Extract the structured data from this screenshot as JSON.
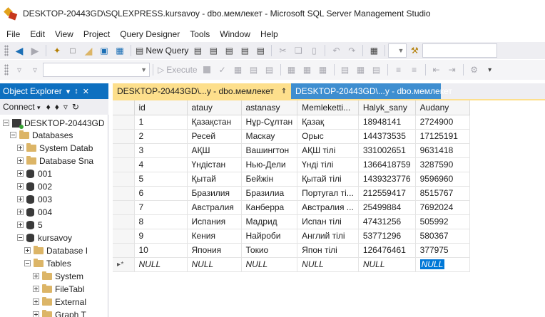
{
  "window": {
    "title": "DESKTOP-20443GD\\SQLEXPRESS.kursavoy - dbo.мемлекет - Microsoft SQL Server Management Studio"
  },
  "menu": [
    "File",
    "Edit",
    "View",
    "Project",
    "Query Designer",
    "Tools",
    "Window",
    "Help"
  ],
  "toolbar": {
    "new_query_label": "New Query",
    "execute_label": "Execute"
  },
  "object_explorer": {
    "title": "Object Explorer",
    "pin_glyph": "↕",
    "close_glyph": "✕",
    "connect_label": "Connect",
    "tree": [
      {
        "label": "DESKTOP-20443GD",
        "icon": "server-icon",
        "expanded": true,
        "level": 0
      },
      {
        "label": "Databases",
        "icon": "folder-icon",
        "expanded": true,
        "level": 1
      },
      {
        "label": "System Datab",
        "icon": "folder-icon",
        "expanded": false,
        "level": 2
      },
      {
        "label": "Database Sna",
        "icon": "folder-icon",
        "expanded": false,
        "level": 2
      },
      {
        "label": "001",
        "icon": "database-icon",
        "expanded": false,
        "level": 2
      },
      {
        "label": "002",
        "icon": "database-icon",
        "expanded": false,
        "level": 2
      },
      {
        "label": "003",
        "icon": "database-icon",
        "expanded": false,
        "level": 2
      },
      {
        "label": "004",
        "icon": "database-icon",
        "expanded": false,
        "level": 2
      },
      {
        "label": "5",
        "icon": "database-icon",
        "expanded": false,
        "level": 2
      },
      {
        "label": "kursavoy",
        "icon": "database-icon",
        "expanded": true,
        "level": 2
      },
      {
        "label": "Database I",
        "icon": "folder-icon",
        "expanded": false,
        "level": 3
      },
      {
        "label": "Tables",
        "icon": "folder-icon",
        "expanded": true,
        "level": 3
      },
      {
        "label": "System",
        "icon": "folder-icon",
        "expanded": false,
        "level": 4
      },
      {
        "label": "FileTabl",
        "icon": "folder-icon",
        "expanded": false,
        "level": 4
      },
      {
        "label": "External",
        "icon": "folder-icon",
        "expanded": false,
        "level": 4
      },
      {
        "label": "Graph T",
        "icon": "folder-icon",
        "expanded": false,
        "level": 4
      }
    ]
  },
  "tabs": [
    {
      "label": "DESKTOP-20443GD\\...y - dbo.мемлекет",
      "pin": "⇑",
      "close": "✕",
      "active": true
    },
    {
      "label": "DESKTOP-20443GD\\...y - dbo.мемлекет",
      "active": false
    }
  ],
  "grid": {
    "columns": [
      "id",
      "atauy",
      "astanasy",
      "Memleketti...",
      "Halyk_sany",
      "Audany"
    ],
    "rows": [
      [
        "1",
        "Қазақстан",
        "Нұр-Сұлтан",
        "Қазақ",
        "18948141",
        "2724900"
      ],
      [
        "2",
        "Ресей",
        "Маскау",
        "Орыс",
        "144373535",
        "17125191"
      ],
      [
        "3",
        "АҚШ",
        "Вашингтон",
        "АҚШ тілі",
        "331002651",
        "9631418"
      ],
      [
        "4",
        "Үндістан",
        "Нью-Дели",
        "Үнді тілі",
        "1366418759",
        "3287590"
      ],
      [
        "5",
        "Қытай",
        "Бейжін",
        "Қытай тілі",
        "1439323776",
        "9596960"
      ],
      [
        "6",
        "Бразилия",
        "Бразилиа",
        "Португал ті...",
        "212559417",
        "8515767"
      ],
      [
        "7",
        "Австралия",
        "Канберра",
        "Австралия ...",
        "25499884",
        "7692024"
      ],
      [
        "8",
        "Испания",
        "Мадрид",
        "Испан тілі",
        "47431256",
        "505992"
      ],
      [
        "9",
        "Кения",
        "Найроби",
        "Англий тілі",
        "53771296",
        "580367"
      ],
      [
        "10",
        "Япония",
        "Токио",
        "Япон тілі",
        "126476461",
        "377975"
      ]
    ],
    "new_row_marker": "▸*",
    "new_row": [
      "NULL",
      "NULL",
      "NULL",
      "NULL",
      "NULL",
      "NULL"
    ]
  }
}
